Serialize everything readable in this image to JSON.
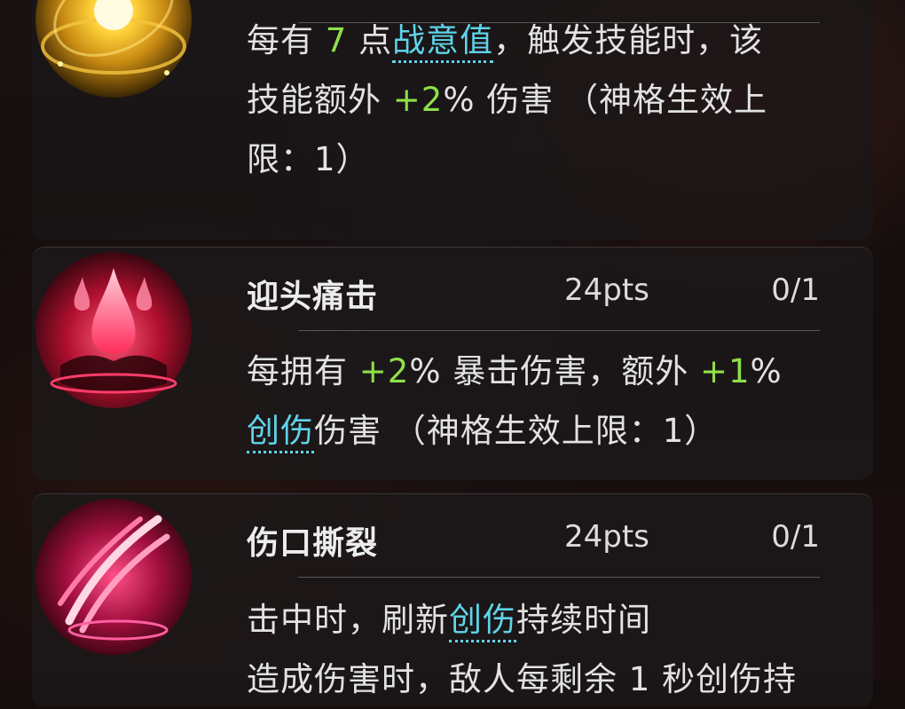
{
  "talents": [
    {
      "desc": {
        "l1a": "每有 ",
        "l1b": "7",
        "l1c": " 点",
        "l1kw": "战意值",
        "l1d": "，触发技能时，该",
        "l2a": "技能额外 ",
        "l2b": "+2",
        "l2c": "% 伤害 （神格生效上",
        "l3": "限：1）"
      },
      "icon": "golden-orb-icon"
    },
    {
      "name": "迎头痛击",
      "points": "24pts",
      "count": "0/1",
      "desc": {
        "l1a": "每拥有 ",
        "l1b": "+2",
        "l1c": "% 暴击伤害，额外 ",
        "l1d": "+1",
        "l1e": "%",
        "l2kw": "创伤",
        "l2a": "伤害 （神格生效上限：1）"
      },
      "icon": "crimson-droplet-icon"
    },
    {
      "name": "伤口撕裂",
      "points": "24pts",
      "count": "0/1",
      "desc": {
        "l1a": "击中时，刷新",
        "l1kw": "创伤",
        "l1b": "持续时间",
        "l2": "造成伤害时，敌人每剩余 1 秒创伤持"
      },
      "icon": "crimson-claw-icon"
    }
  ],
  "colors": {
    "number_green": "#8ee04a",
    "keyword_cyan": "#5fd3ea"
  }
}
